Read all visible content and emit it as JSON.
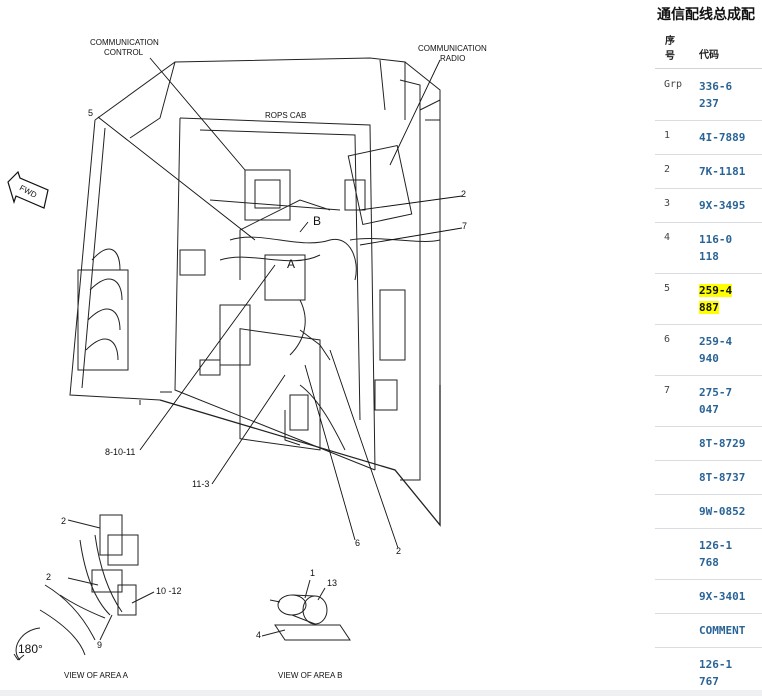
{
  "diagram": {
    "labels": {
      "comm_control_1": "COMMUNICATION",
      "comm_control_2": "CONTROL",
      "comm_radio_1": "COMMUNICATION",
      "comm_radio_2": "RADIO",
      "rops_cab": "ROPS CAB",
      "fwd": "FWD",
      "callout_a": "A",
      "callout_b": "B",
      "view_a": "VIEW OF AREA  A",
      "view_b": "VIEW OF AREA B",
      "rotation": "180°"
    },
    "callouts": {
      "c5": "5",
      "c2_top": "2",
      "c7": "7",
      "c8_10_11": "8-10-11",
      "c11_3": "11-3",
      "c6": "6",
      "c2_bottom": "2",
      "a_2_top": "2",
      "a_2_mid": "2",
      "a_10_12": "10 -12",
      "a_9": "9",
      "b_1": "1",
      "b_13": "13",
      "b_4": "4"
    }
  },
  "panel": {
    "title": "通信配线总成配",
    "header": {
      "seq": "序号",
      "code": "代码"
    },
    "rows": [
      {
        "grp": "Grp",
        "part": "336-6237"
      },
      {
        "grp": "1",
        "part": "4I-7889"
      },
      {
        "grp": "2",
        "part": "7K-1181"
      },
      {
        "grp": "3",
        "part": "9X-3495"
      },
      {
        "grp": "4",
        "part": "116-0118"
      },
      {
        "grp": "5",
        "part": "259-4887",
        "highlighted": true
      },
      {
        "grp": "6",
        "part": "259-4940"
      },
      {
        "grp": "7",
        "part": "275-7047"
      },
      {
        "grp": "",
        "part": "8T-8729"
      },
      {
        "grp": "",
        "part": "8T-8737"
      },
      {
        "grp": "",
        "part": "9W-0852"
      },
      {
        "grp": "",
        "part": "126-1768"
      },
      {
        "grp": "",
        "part": "9X-3401"
      },
      {
        "grp": "",
        "part": "COMMENT"
      },
      {
        "grp": "",
        "part": "126-1767"
      }
    ]
  }
}
